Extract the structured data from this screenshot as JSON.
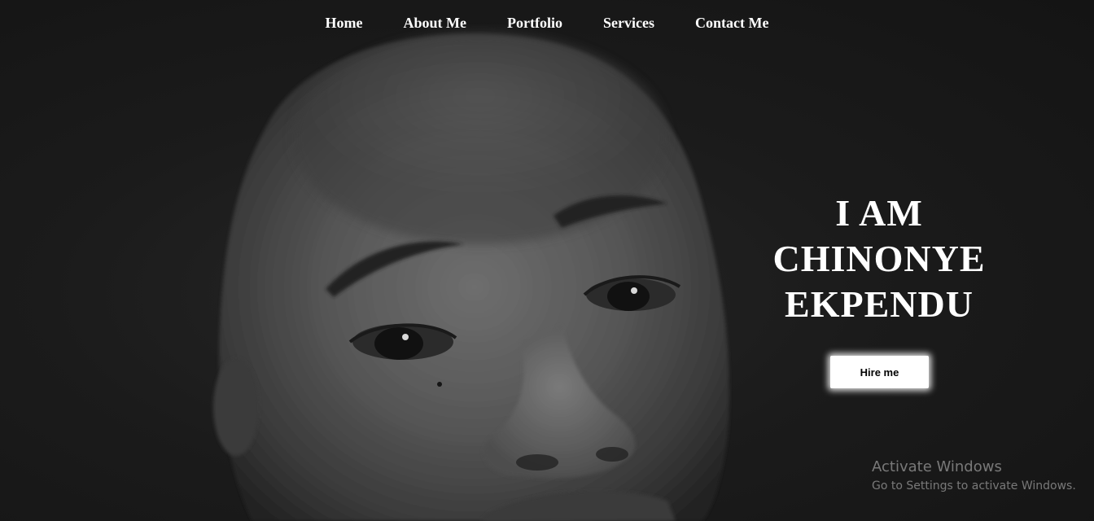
{
  "nav": {
    "items": [
      {
        "label": "Home"
      },
      {
        "label": "About Me"
      },
      {
        "label": "Portfolio"
      },
      {
        "label": "Services"
      },
      {
        "label": "Contact Me"
      }
    ]
  },
  "hero": {
    "line1": "I AM",
    "line2": "CHINONYE",
    "line3": "EKPENDU",
    "cta_label": "Hire me"
  },
  "watermark": {
    "title": "Activate Windows",
    "subtitle": "Go to Settings to activate Windows."
  },
  "colors": {
    "background": "#161616",
    "text": "#ffffff",
    "button_bg": "#ffffff",
    "button_text": "#000000"
  }
}
